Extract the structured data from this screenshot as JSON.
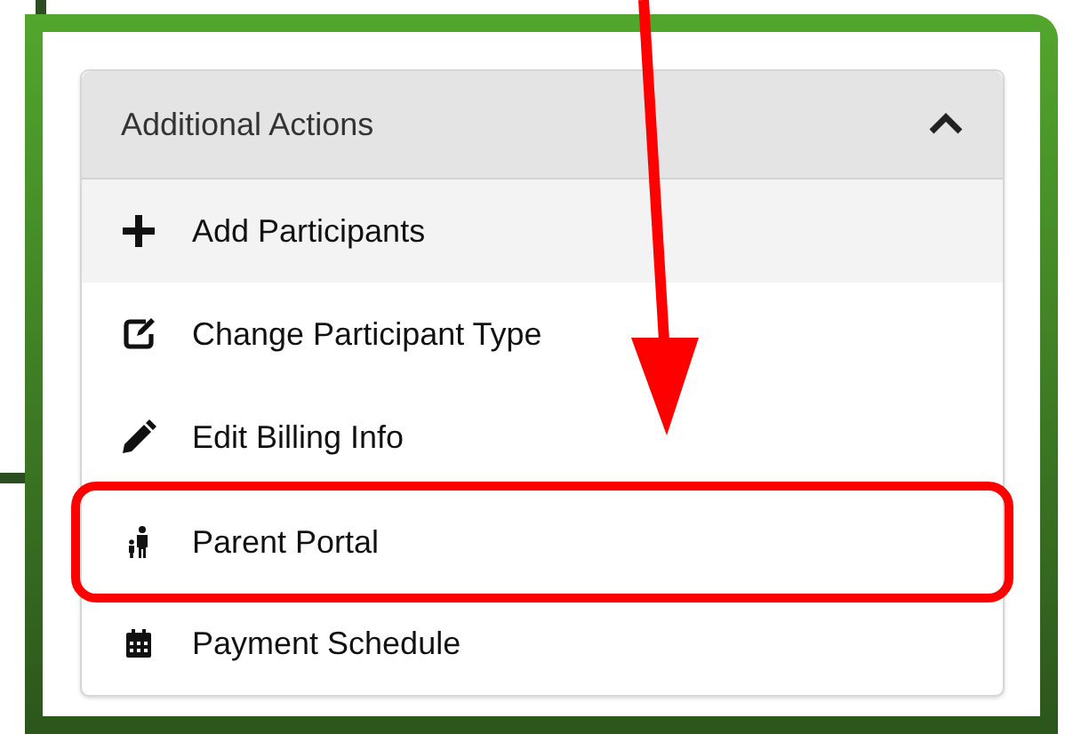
{
  "panel": {
    "title": "Additional Actions",
    "expanded": true,
    "items": [
      {
        "label": "Add Participants",
        "hovered": true,
        "annotated": false
      },
      {
        "label": "Change Participant Type",
        "hovered": false,
        "annotated": false
      },
      {
        "label": "Edit Billing Info",
        "hovered": false,
        "annotated": false
      },
      {
        "label": "Parent Portal",
        "hovered": false,
        "annotated": true
      },
      {
        "label": "Payment Schedule",
        "hovered": false,
        "annotated": false
      }
    ]
  }
}
